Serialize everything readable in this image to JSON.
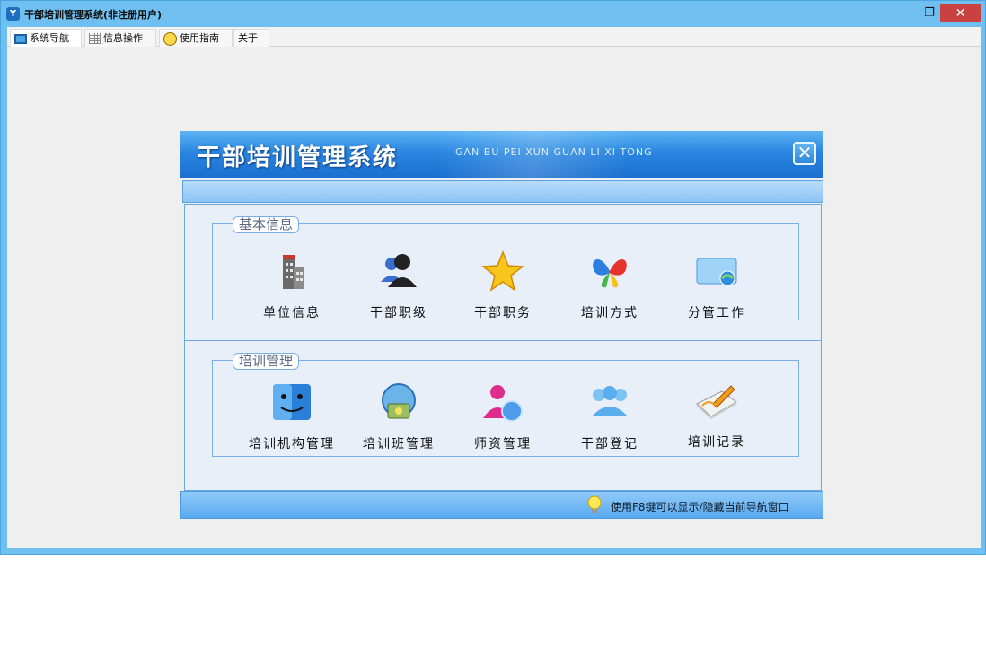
{
  "window": {
    "title": "干部培训管理系统(非注册用户)",
    "app_icon": "app-logo-icon",
    "controls": {
      "minimize": "–",
      "restore": "❐",
      "close": "✕"
    }
  },
  "menu": {
    "items": [
      {
        "label": "系统导航",
        "icon": "monitor-icon"
      },
      {
        "label": "信息操作",
        "icon": "grid-icon"
      },
      {
        "label": "使用指南",
        "icon": "smiley-icon"
      },
      {
        "label": "关于"
      }
    ]
  },
  "nav_window": {
    "title": "干部培训管理系统",
    "pinyin": "GAN BU PEI XUN GUAN LI XI TONG",
    "close_symbol": "✕",
    "groups": [
      {
        "label": "基本信息",
        "items": [
          {
            "label": "单位信息",
            "icon": "building-icon"
          },
          {
            "label": "干部职级",
            "icon": "users-icon"
          },
          {
            "label": "干部职务",
            "icon": "star-icon"
          },
          {
            "label": "培训方式",
            "icon": "butterfly-icon"
          },
          {
            "label": "分管工作",
            "icon": "card-globe-icon"
          }
        ]
      },
      {
        "label": "培训管理",
        "items": [
          {
            "label": "培训机构管理",
            "icon": "finder-icon"
          },
          {
            "label": "培训班管理",
            "icon": "network-icon"
          },
          {
            "label": "师资管理",
            "icon": "teacher-icon"
          },
          {
            "label": "干部登记",
            "icon": "group-icon"
          },
          {
            "label": "培训记录",
            "icon": "notebook-pen-icon"
          }
        ]
      }
    ],
    "footer": "使用F8键可以显示/隐藏当前导航窗口"
  },
  "colors": {
    "window_frame": "#6fc0f0",
    "close_button": "#c94141",
    "nav_header": "#2a86e0",
    "panel_bg": "#e9eff9",
    "group_border": "#7aaee6"
  }
}
